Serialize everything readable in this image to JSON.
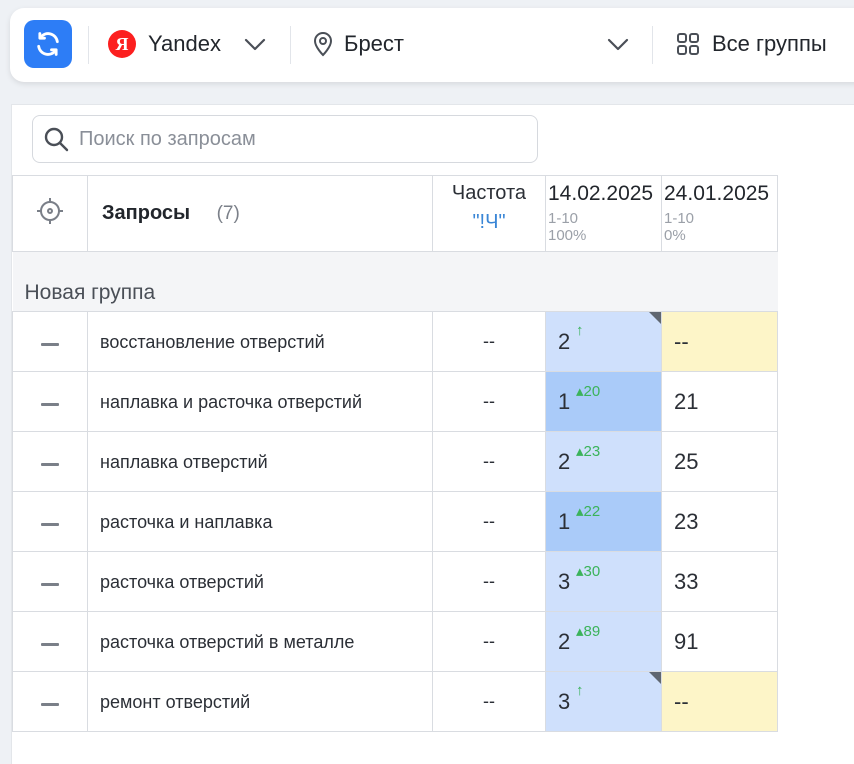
{
  "toolbar": {
    "refresh_icon": "refresh-icon",
    "engine": {
      "label": "Yandex",
      "logo_letter": "Я",
      "logo_color": "#fc1f1f"
    },
    "region": {
      "label": "Брест"
    },
    "groups": {
      "label": "Все группы"
    }
  },
  "search": {
    "placeholder": "Поиск по запросам"
  },
  "table": {
    "header": {
      "queries_title": "Запросы",
      "queries_count": "(7)",
      "frequency_title": "Частота",
      "frequency_sub": "\"!Ч\"",
      "dates": [
        {
          "date": "14.02.2025",
          "range": "1-10",
          "percent": "100%"
        },
        {
          "date": "24.01.2025",
          "range": "1-10",
          "percent": "0%"
        }
      ]
    },
    "group_name": "Новая группа",
    "rows": [
      {
        "query": "восстановление отверстий",
        "freq": "--",
        "pos": "2",
        "delta": "↑",
        "prev": "--"
      },
      {
        "query": "наплавка и расточка отверстий",
        "freq": "--",
        "pos": "1",
        "delta": "▴20",
        "prev": "21"
      },
      {
        "query": "наплавка отверстий",
        "freq": "--",
        "pos": "2",
        "delta": "▴23",
        "prev": "25"
      },
      {
        "query": "расточка и наплавка",
        "freq": "--",
        "pos": "1",
        "delta": "▴22",
        "prev": "23"
      },
      {
        "query": "расточка отверстий",
        "freq": "--",
        "pos": "3",
        "delta": "▴30",
        "prev": "33"
      },
      {
        "query": "расточка отверстий в металле",
        "freq": "--",
        "pos": "2",
        "delta": "▴89",
        "prev": "91"
      },
      {
        "query": "ремонт отверстий",
        "freq": "--",
        "pos": "3",
        "delta": "↑",
        "prev": "--"
      }
    ]
  },
  "colors": {
    "accent": "#2d7df6",
    "position_cell": "#cfe0fc",
    "position_top1": "#aacbf9",
    "na_cell": "#fdf5c8",
    "delta_up": "#3bb35a"
  }
}
